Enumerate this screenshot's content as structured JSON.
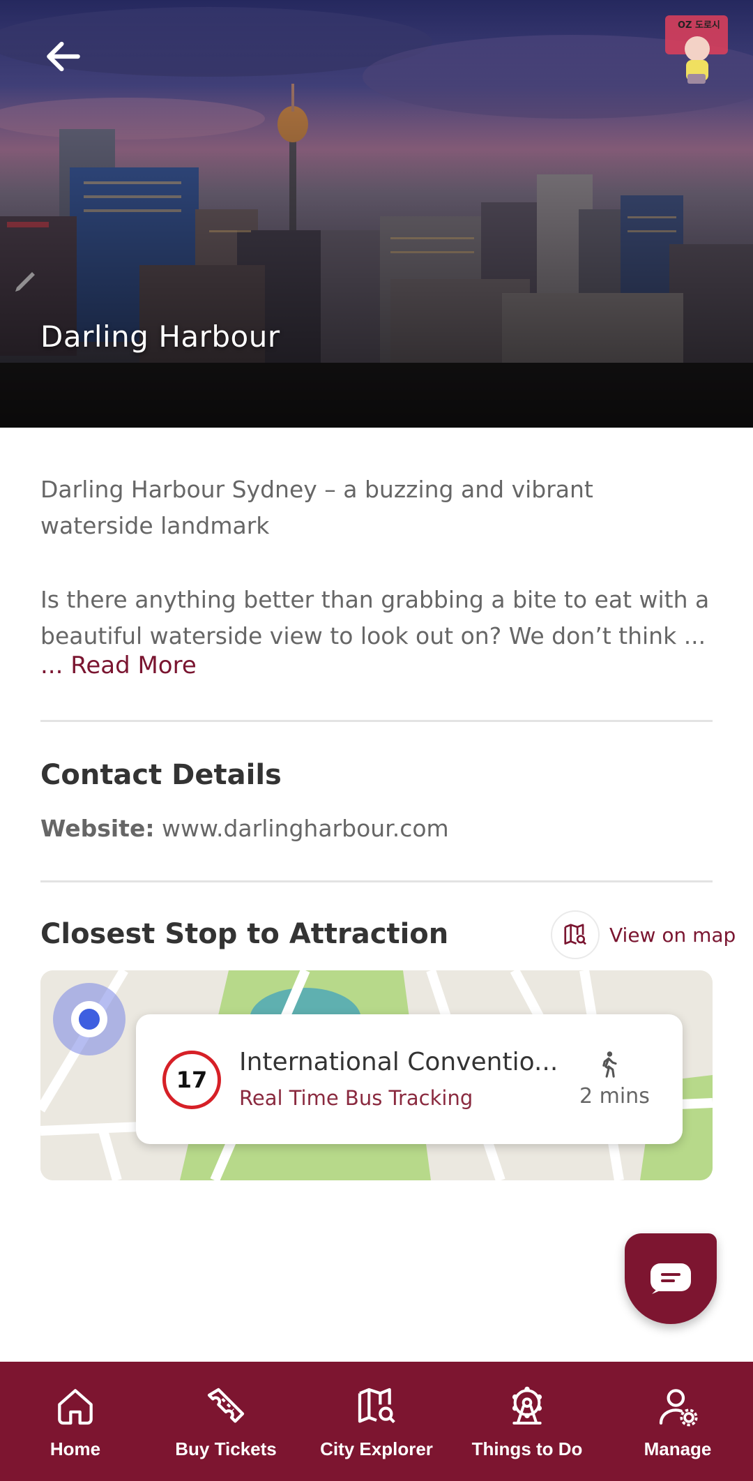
{
  "hero": {
    "title": "Darling Harbour",
    "back_icon": "arrow-left-icon",
    "mascot_badge": "OZ 도로시",
    "edit_icon": "pencil-icon"
  },
  "description": {
    "line1": "Darling Harbour Sydney – a buzzing and vibrant waterside landmark",
    "line2": "Is there anything better than grabbing a bite to eat with a beautiful waterside view to look out on? We don’t think ...",
    "read_more": "... Read More"
  },
  "contact": {
    "title": "Contact Details",
    "website_label": "Website:",
    "website_value": "www.darlingharbour.com"
  },
  "closest_stop": {
    "title": "Closest Stop to Attraction",
    "view_on_map": "View on map",
    "route_number": "17",
    "stop_name": "International Conventio...",
    "tracking_label": "Real Time Bus Tracking",
    "walk_time": "2 mins"
  },
  "nav": {
    "items": [
      {
        "label": "Home",
        "icon": "home-icon"
      },
      {
        "label": "Buy Tickets",
        "icon": "ticket-icon"
      },
      {
        "label": "City Explorer",
        "icon": "map-search-icon"
      },
      {
        "label": "Things to Do",
        "icon": "ferris-wheel-icon"
      },
      {
        "label": "Manage",
        "icon": "user-settings-icon"
      }
    ]
  },
  "colors": {
    "brand": "#7d1530",
    "route_red": "#d62027"
  }
}
